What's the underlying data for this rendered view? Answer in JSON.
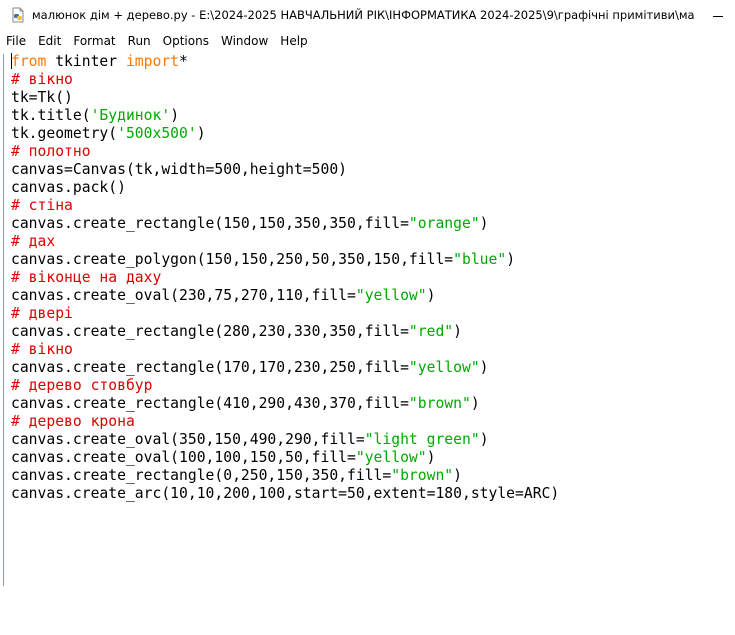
{
  "window": {
    "title": "малюнок дім + дерево.py - E:\\2024-2025 НАВЧАЛЬНИЙ РІК\\ІНФОРМАТИКА 2024-2025\\9\\графічні примітиви\\малюно..."
  },
  "menu": {
    "items": [
      "File",
      "Edit",
      "Format",
      "Run",
      "Options",
      "Window",
      "Help"
    ]
  },
  "editor": {
    "lines": [
      [
        {
          "t": "from",
          "c": "kw"
        },
        {
          "t": " tkinter ",
          "c": ""
        },
        {
          "t": "import",
          "c": "kw"
        },
        {
          "t": "*",
          "c": ""
        }
      ],
      [
        {
          "t": "# вікно",
          "c": "cm"
        }
      ],
      [
        {
          "t": "tk=Tk()",
          "c": ""
        }
      ],
      [
        {
          "t": "tk.title(",
          "c": ""
        },
        {
          "t": "'Будинок'",
          "c": "st"
        },
        {
          "t": ")",
          "c": ""
        }
      ],
      [
        {
          "t": "tk.geometry(",
          "c": ""
        },
        {
          "t": "'500x500'",
          "c": "st"
        },
        {
          "t": ")",
          "c": ""
        }
      ],
      [
        {
          "t": "# полотно",
          "c": "cm"
        }
      ],
      [
        {
          "t": "canvas=Canvas(tk,width=500,height=500)",
          "c": ""
        }
      ],
      [
        {
          "t": "canvas.pack()",
          "c": ""
        }
      ],
      [
        {
          "t": "# стіна",
          "c": "cm"
        }
      ],
      [
        {
          "t": "canvas.create_rectangle(150,150,350,350,fill=",
          "c": ""
        },
        {
          "t": "\"orange\"",
          "c": "st"
        },
        {
          "t": ")",
          "c": ""
        }
      ],
      [
        {
          "t": "# дах",
          "c": "cm"
        }
      ],
      [
        {
          "t": "canvas.create_polygon(150,150,250,50,350,150,fill=",
          "c": ""
        },
        {
          "t": "\"blue\"",
          "c": "st"
        },
        {
          "t": ")",
          "c": ""
        }
      ],
      [
        {
          "t": "# віконце на даху",
          "c": "cm"
        }
      ],
      [
        {
          "t": "canvas.create_oval(230,75,270,110,fill=",
          "c": ""
        },
        {
          "t": "\"yellow\"",
          "c": "st"
        },
        {
          "t": ")",
          "c": ""
        }
      ],
      [
        {
          "t": "# двері",
          "c": "cm"
        }
      ],
      [
        {
          "t": "canvas.create_rectangle(280,230,330,350,fill=",
          "c": ""
        },
        {
          "t": "\"red\"",
          "c": "st"
        },
        {
          "t": ")",
          "c": ""
        }
      ],
      [
        {
          "t": "# вікно",
          "c": "cm"
        }
      ],
      [
        {
          "t": "canvas.create_rectangle(170,170,230,250,fill=",
          "c": ""
        },
        {
          "t": "\"yellow\"",
          "c": "st"
        },
        {
          "t": ")",
          "c": ""
        }
      ],
      [
        {
          "t": "# дерево стовбур",
          "c": "cm"
        }
      ],
      [
        {
          "t": "canvas.create_rectangle(410,290,430,370,fill=",
          "c": ""
        },
        {
          "t": "\"brown\"",
          "c": "st"
        },
        {
          "t": ")",
          "c": ""
        }
      ],
      [
        {
          "t": "# дерево крона",
          "c": "cm"
        }
      ],
      [
        {
          "t": "canvas.create_oval(350,150,490,290,fill=",
          "c": ""
        },
        {
          "t": "\"light green\"",
          "c": "st"
        },
        {
          "t": ")",
          "c": ""
        }
      ],
      [
        {
          "t": "canvas.create_oval(100,100,150,50,fill=",
          "c": ""
        },
        {
          "t": "\"yellow\"",
          "c": "st"
        },
        {
          "t": ")",
          "c": ""
        }
      ],
      [
        {
          "t": "canvas.create_rectangle(0,250,150,350,fill=",
          "c": ""
        },
        {
          "t": "\"brown\"",
          "c": "st"
        },
        {
          "t": ")",
          "c": ""
        }
      ],
      [
        {
          "t": "canvas.create_arc(10,10,200,100,start=50,extent=180,style=ARC)",
          "c": ""
        }
      ]
    ]
  },
  "colors": {
    "keyword": "#ff7700",
    "comment": "#dd0000",
    "string": "#00aa00",
    "text": "#000000",
    "background": "#ffffff"
  },
  "icons": {
    "app": "python-file-icon",
    "minimize": "minimize-icon"
  }
}
